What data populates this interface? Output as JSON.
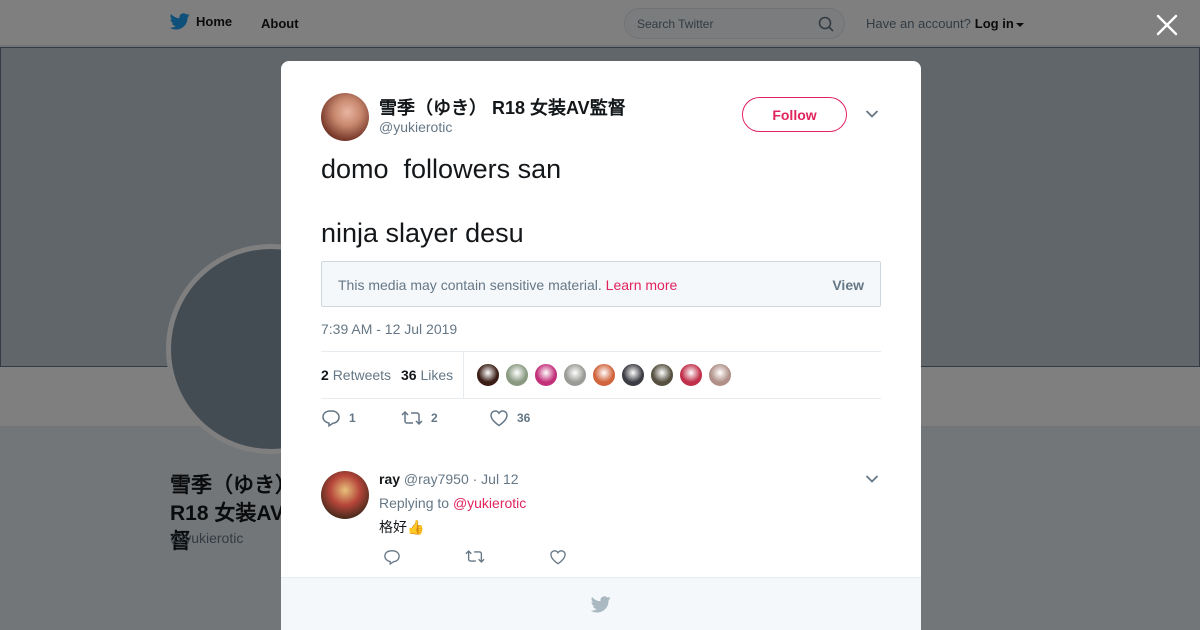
{
  "nav": {
    "home_label": "Home",
    "about_label": "About",
    "search_placeholder": "Search Twitter",
    "account_prompt": "Have an account?",
    "login_label": "Log in"
  },
  "profile_bg": {
    "name": "雪季（ゆき） R18 女装AV監督",
    "handle": "@yukierotic"
  },
  "tweet": {
    "author_name": "雪季（ゆき） R18 女装AV監督",
    "author_handle": "@yukierotic",
    "follow_label": "Follow",
    "text_lines": [
      "domo  followers san",
      "",
      "ninja slayer desu"
    ],
    "sensitive_text": "This media may contain sensitive material.",
    "sensitive_link": "Learn more",
    "sensitive_view": "View",
    "timestamp": "7:39 AM - 12 Jul 2019",
    "retweets_count": "2",
    "retweets_label": "Retweets",
    "likes_count": "36",
    "likes_label": "Likes",
    "liker_colors": [
      "#3a1d16",
      "#8a9a82",
      "#c2307a",
      "#9a9a96",
      "#d0643c",
      "#3c3c44",
      "#565040",
      "#c0304a",
      "#b09088"
    ],
    "reply_count": "1",
    "retweet_action_count": "2",
    "like_action_count": "36"
  },
  "reply": {
    "name": "ray",
    "handle": "@ray7950",
    "date": "· Jul 12",
    "replying_prefix": "Replying to",
    "replying_to": "@yukierotic",
    "body": "格好👍"
  },
  "colors": {
    "accent": "#e0245e",
    "twitter_blue": "#1da1f2",
    "muted": "#657786"
  }
}
